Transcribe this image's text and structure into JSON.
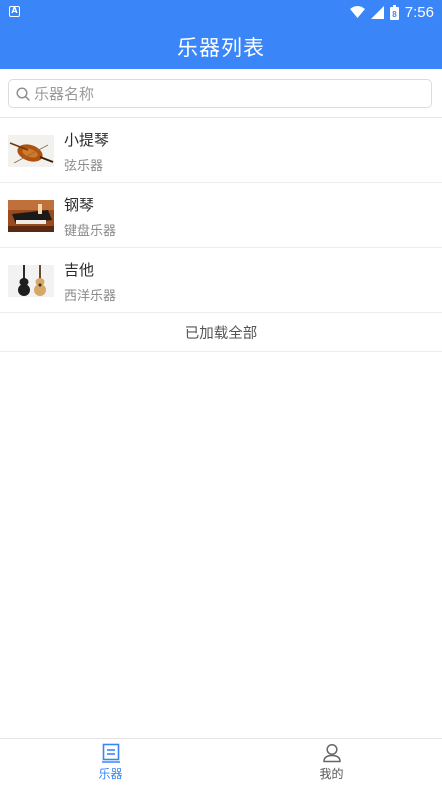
{
  "status_bar": {
    "time": "7:56",
    "battery_level": "8"
  },
  "header": {
    "title": "乐器列表"
  },
  "search": {
    "placeholder": "乐器名称",
    "value": ""
  },
  "instruments": [
    {
      "name": "小提琴",
      "type": "弦乐器",
      "image": "violin-photo"
    },
    {
      "name": "钢琴",
      "type": "键盘乐器",
      "image": "piano-photo"
    },
    {
      "name": "吉他",
      "type": "西洋乐器",
      "image": "guitar-photo"
    }
  ],
  "list_footer": "已加载全部",
  "tabs": [
    {
      "label": "乐器",
      "icon": "list-icon",
      "active": true
    },
    {
      "label": "我的",
      "icon": "user-icon",
      "active": false
    }
  ],
  "colors": {
    "primary": "#3a86f8",
    "active_tab": "#3a86f8",
    "inactive_tab": "#555555"
  }
}
